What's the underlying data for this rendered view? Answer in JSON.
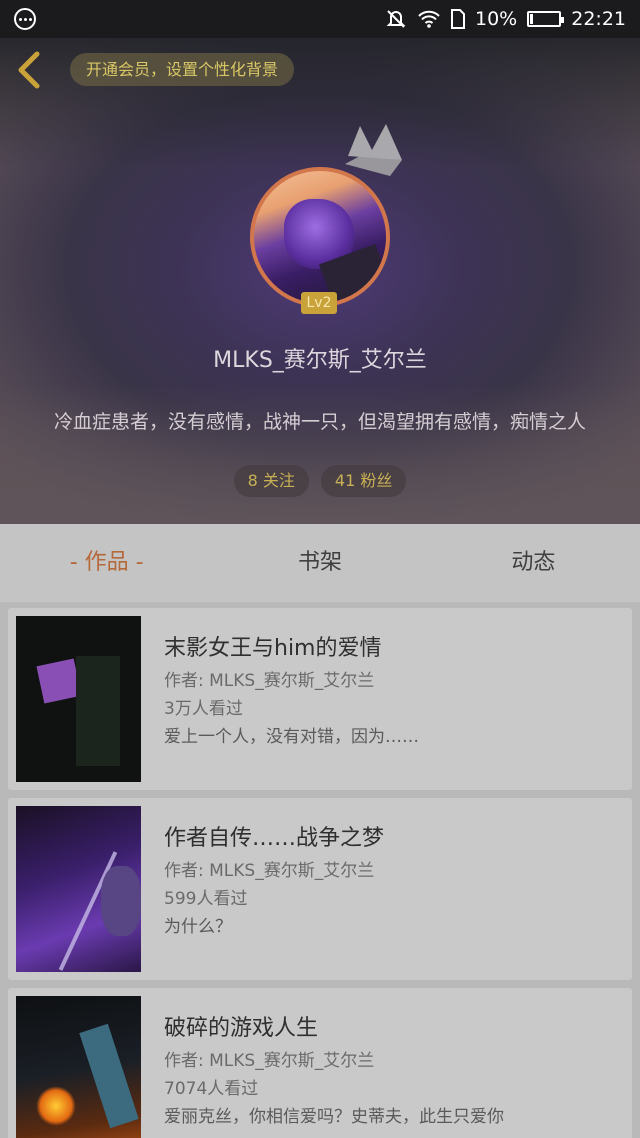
{
  "status_bar": {
    "time": "22:21",
    "battery_text": "10%",
    "battery_level": 0.1,
    "icons": [
      "more-dots-icon",
      "mute-icon",
      "wifi-icon",
      "sim-icon",
      "battery-icon"
    ]
  },
  "header": {
    "vip_banner": "开通会员，设置个性化背景",
    "level": "Lv2",
    "username": "MLKS_赛尔斯_艾尔兰",
    "bio": "冷血症患者，没有感情，战神一只，但渴望拥有感情，痴情之人",
    "following": "8 关注",
    "followers": "41 粉丝",
    "colors": {
      "badge": "#c9a33a",
      "accent": "#b5683a"
    }
  },
  "tabs": [
    {
      "label": "- 作品 -",
      "active": true
    },
    {
      "label": "书架",
      "active": false
    },
    {
      "label": "动态",
      "active": false
    }
  ],
  "works": [
    {
      "title": "末影女王与him的爱情",
      "author": "作者: MLKS_赛尔斯_艾尔兰",
      "views": "3万人看过",
      "excerpt": "爱上一个人，没有对错，因为……"
    },
    {
      "title": "作者自传……战争之梦",
      "author": "作者: MLKS_赛尔斯_艾尔兰",
      "views": "599人看过",
      "excerpt": "为什么？"
    },
    {
      "title": "破碎的游戏人生",
      "author": "作者: MLKS_赛尔斯_艾尔兰",
      "views": "7074人看过",
      "excerpt": "爱丽克丝，你相信爱吗？史蒂夫，此生只爱你"
    }
  ]
}
